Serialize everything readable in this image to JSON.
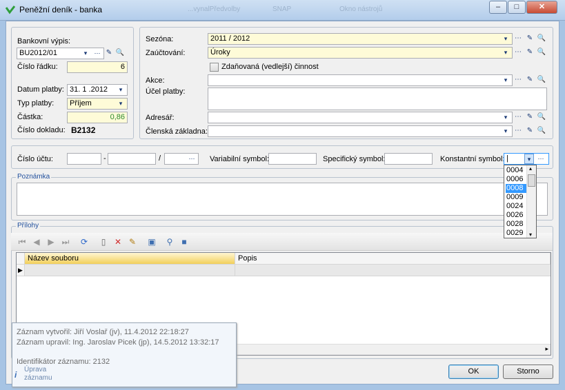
{
  "window": {
    "title": "Peněžní deník - banka",
    "bg_fragments": [
      "...vynalPředvolby",
      "SNAP",
      "Okno nástrojů"
    ],
    "min": "–",
    "max": "□",
    "close": "✕"
  },
  "left_group": {
    "bankovni_vypis_label": "Bankovní výpis:",
    "bankovni_vypis_value": "BU2012/01",
    "cislo_radku_label": "Číslo řádku:",
    "cislo_radku_value": "6",
    "datum_platby_label": "Datum platby:",
    "datum_platby_value": "31. 1 .2012",
    "typ_platby_label": "Typ platby:",
    "typ_platby_value": "Příjem",
    "castka_label": "Částka:",
    "castka_value": "0,86",
    "cislo_dokladu_label": "Číslo dokladu:",
    "cislo_dokladu_value": "B2132"
  },
  "right_group": {
    "sezona_label": "Sezóna:",
    "sezona_value": "2011 / 2012",
    "zauctovani_label": "Zaúčtování:",
    "zauctovani_value": "Úroky",
    "zdanovana_label": "Zdaňovaná (vedlejší) činnost",
    "zdanovana_checked": false,
    "akce_label": "Akce:",
    "akce_value": "",
    "ucel_label": "Účel platby:",
    "ucel_value": "",
    "adresar_label": "Adresář:",
    "adresar_value": "",
    "clenska_label": "Členská základna:",
    "clenska_value": ""
  },
  "account_row": {
    "cislo_uctu_label": "Číslo účtu:",
    "sep_dash": "-",
    "sep_slash": "/",
    "variabilni_label": "Variabilní symbol:",
    "specificky_label": "Specifický symbol:",
    "konstantni_label": "Konstantní symbol:",
    "konstantni_value": "|"
  },
  "konstantni_dropdown": {
    "options": [
      "0004",
      "0006",
      "0008",
      "0009",
      "0024",
      "0026",
      "0028",
      "0029"
    ],
    "selected": "0008"
  },
  "poznamka": {
    "title": "Poznámka",
    "value": ""
  },
  "prilohy": {
    "title": "Přílohy",
    "columns": [
      "Název souboru",
      "Popis"
    ]
  },
  "tooltip": {
    "created": "Záznam vytvořil:  Jiří Voslař (jv), 11.4.2012 22:18:27",
    "modified": "Záznam upravil:  Ing. Jaroslav Picek (jp), 14.5.2012 13:32:17",
    "identifier": "Identifikátor záznamu:  2132"
  },
  "info": {
    "upravit_line1": "Úprava",
    "upravit_line2": "záznamu"
  },
  "buttons": {
    "ok": "OK",
    "storno": "Storno"
  },
  "icons": {
    "dropdown": "▾",
    "ellipsis": "⋯",
    "edit": "✎",
    "search": "🔍"
  }
}
